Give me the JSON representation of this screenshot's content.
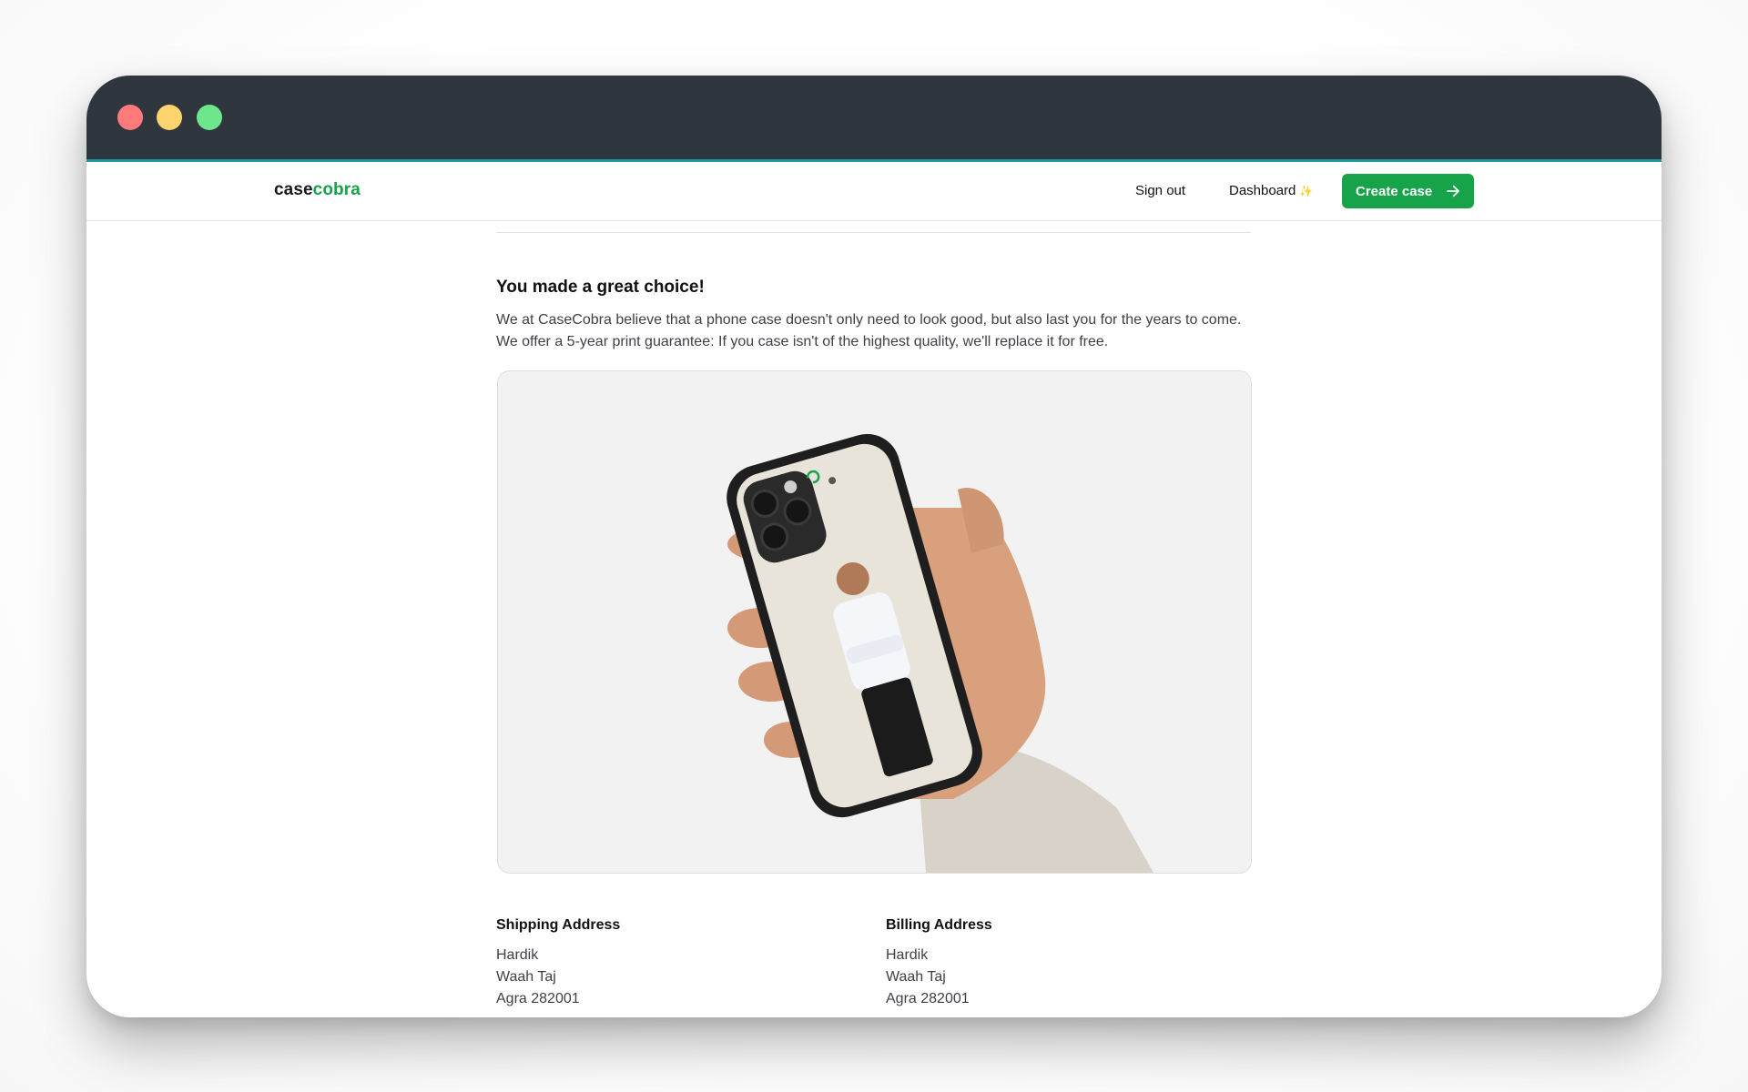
{
  "window": {
    "controls": [
      "close",
      "minimize",
      "maximize"
    ]
  },
  "nav": {
    "logo_primary": "case",
    "logo_accent": "cobra",
    "sign_out": "Sign out",
    "dashboard": "Dashboard",
    "dashboard_icon": "sparkle-icon",
    "create_case": "Create case",
    "create_case_icon": "arrow-right-icon"
  },
  "content": {
    "heading": "You made a great choice!",
    "paragraph": "We at CaseCobra believe that a phone case doesn't only need to look good, but also last you for the years to come. We offer a 5-year print guarantee: If you case isn't of the highest quality, we'll replace it for free."
  },
  "shipping": {
    "title": "Shipping Address",
    "name": "Hardik",
    "street": "Waah Taj",
    "city": "Agra 282001"
  },
  "billing": {
    "title": "Billing Address",
    "name": "Hardik",
    "street": "Waah Taj",
    "city": "Agra 282001"
  },
  "colors": {
    "accent": "#16a34a",
    "titlebar": "#2f363d"
  }
}
